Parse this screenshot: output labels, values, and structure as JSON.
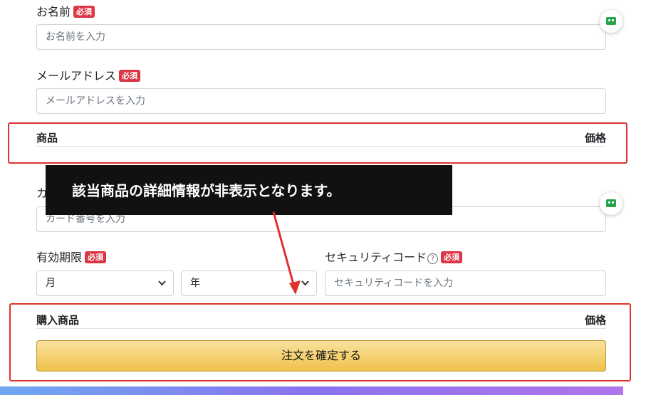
{
  "form": {
    "name": {
      "label": "お名前",
      "required": "必須",
      "placeholder": "お名前を入力"
    },
    "email": {
      "label": "メールアドレス",
      "required": "必須",
      "placeholder": "メールアドレスを入力"
    },
    "card": {
      "label_partial": "カ",
      "placeholder": "カード番号を入力"
    },
    "expiry": {
      "label": "有効期限",
      "required": "必須",
      "month_value": "月",
      "year_value": "年"
    },
    "security": {
      "label": "セキュリティコード",
      "help_glyph": "?",
      "required": "必須",
      "placeholder": "セキュリティコードを入力"
    }
  },
  "product_table_hidden": {
    "col_product": "商品",
    "col_price": "価格"
  },
  "purchase_table": {
    "col_product": "購入商品",
    "col_price": "価格"
  },
  "confirm_button": "注文を確定する",
  "callout": "該当商品の詳細情報が非表示となります。",
  "accent": {
    "highlight_red": "#e03131",
    "badge_red": "#dc3545",
    "button_gold": "#f0c14b",
    "bot_green": "#27a34a"
  },
  "icons": [
    "robot-chat-icon",
    "help-circle-icon",
    "chevron-down-icon"
  ]
}
